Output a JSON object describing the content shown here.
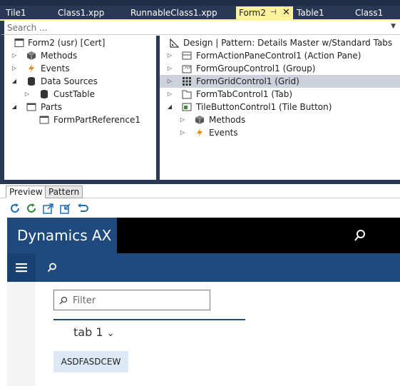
{
  "doc_tabs": [
    {
      "label": "Tile1"
    },
    {
      "label": "Class1.xpp"
    },
    {
      "label": "RunnableClass1.xpp"
    },
    {
      "label": "Form2",
      "active": true
    },
    {
      "label": "Table1"
    },
    {
      "label": "Class1"
    }
  ],
  "doc_tab_icons": {
    "pin": "pin-icon",
    "close": "close-icon"
  },
  "search": {
    "placeholder": "Search ...",
    "value": ""
  },
  "left_tree": {
    "root": "Form2 (usr) [Cert]",
    "methods": "Methods",
    "events": "Events",
    "data_sources": "Data Sources",
    "custtable": "CustTable",
    "parts": "Parts",
    "form_part_reference": "FormPartReference1"
  },
  "right_tree": {
    "design": "Design | Pattern: Details Master w/Standard Tabs",
    "action_pane": "FormActionPaneControl1 (Action Pane)",
    "group": "FormGroupControl1 (Group)",
    "grid": "FormGridControl1 (Grid)",
    "tab": "FormTabControl1 (Tab)",
    "tile_button": "TileButtonControl1 (Tile Button)",
    "methods": "Methods",
    "events": "Events"
  },
  "sub_tabs": {
    "preview": "Preview",
    "pattern": "Pattern"
  },
  "toolbar_icons": [
    "refresh-icon",
    "refresh-alt-icon",
    "open-external-icon",
    "export-icon",
    "undo-icon"
  ],
  "preview": {
    "brand": "Dynamics AX",
    "filter_placeholder": "Filter",
    "tab_label": "tab 1",
    "tile_button_label": "ASDFASDCEW"
  },
  "colors": {
    "chrome": "#293955",
    "active_tab": "#fff29d",
    "ax_blue": "#1f4a7d",
    "selected_row": "#cdd1dc"
  }
}
